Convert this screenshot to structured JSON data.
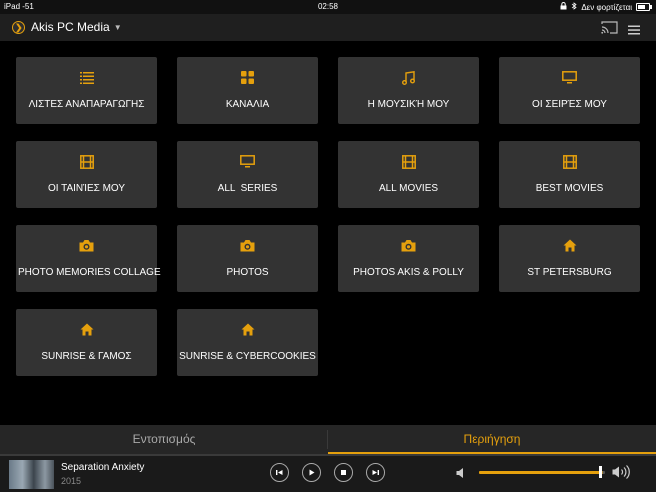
{
  "status_bar": {
    "device": "iPad",
    "signal": "-51",
    "time": "02:58",
    "charging": "Δεν φορτίζεται"
  },
  "header": {
    "server_name": "Akis PC Media"
  },
  "colors": {
    "accent": "#e5a00d",
    "tile": "#333333",
    "background": "#000000"
  },
  "tiles": [
    {
      "label": "ΛΙΣΤΕΣ ΑΝΑΠΑΡΑΓΩΓΗΣ",
      "icon": "list-icon"
    },
    {
      "label": "ΚΑΝΑΛΙΑ",
      "icon": "grid-icon"
    },
    {
      "label": "Η ΜΟΥΣΙΚΉ ΜΟΥ",
      "icon": "music-icon"
    },
    {
      "label": "ΟΙ ΣΕΙΡΈΣ ΜΟΥ",
      "icon": "tv-icon"
    },
    {
      "label": "ΟΙ ΤΑΙΝΊΕΣ ΜΟΥ",
      "icon": "film-icon"
    },
    {
      "label": "ALL  SERIES",
      "icon": "tv-icon"
    },
    {
      "label": "ALL MOVIES",
      "icon": "film-icon"
    },
    {
      "label": "BEST MOVIES",
      "icon": "film-icon"
    },
    {
      "label": "PHOTO MEMORIES COLLAGE",
      "icon": "camera-icon"
    },
    {
      "label": "PHOTOS",
      "icon": "camera-icon"
    },
    {
      "label": "PHOTOS AKIS & POLLY",
      "icon": "camera-icon"
    },
    {
      "label": "ST PETERSBURG",
      "icon": "home-icon"
    },
    {
      "label": "SUNRISE & ΓΑΜΟΣ",
      "icon": "home-icon"
    },
    {
      "label": "SUNRISE & CYBERCOOKIES",
      "icon": "home-icon"
    }
  ],
  "tabs": {
    "locate": "Εντοπισμός",
    "browse": "Περιήγηση"
  },
  "now_playing": {
    "title": "Separation Anxiety",
    "year": "2015",
    "volume": 0.98
  }
}
